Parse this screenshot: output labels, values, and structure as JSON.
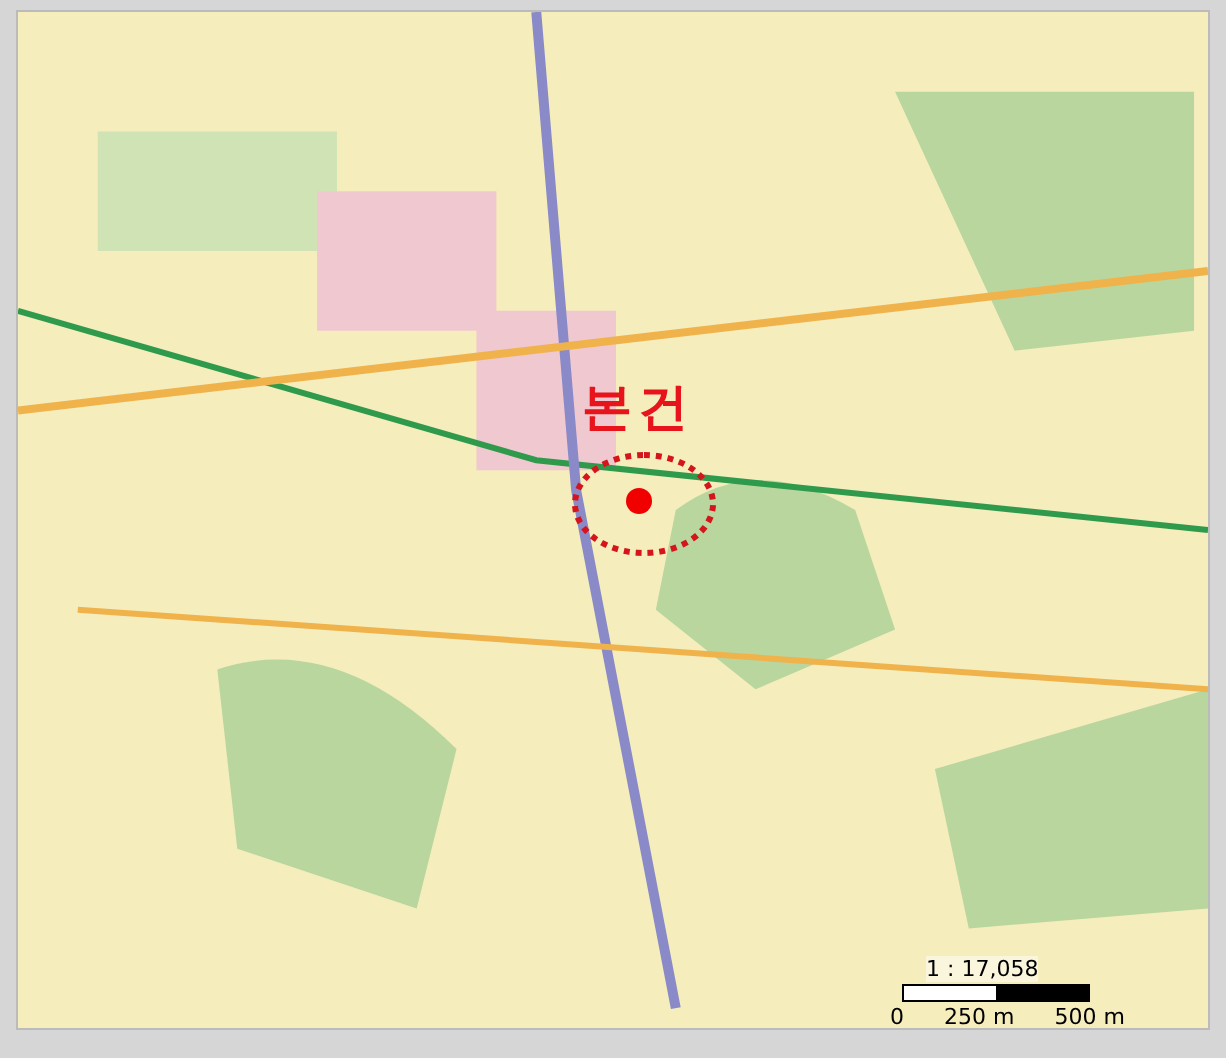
{
  "map": {
    "marker": {
      "label": "본건"
    },
    "scale": {
      "ratio": "1 : 17,058",
      "ticks": [
        "0",
        "250 m",
        "500 m"
      ]
    }
  }
}
